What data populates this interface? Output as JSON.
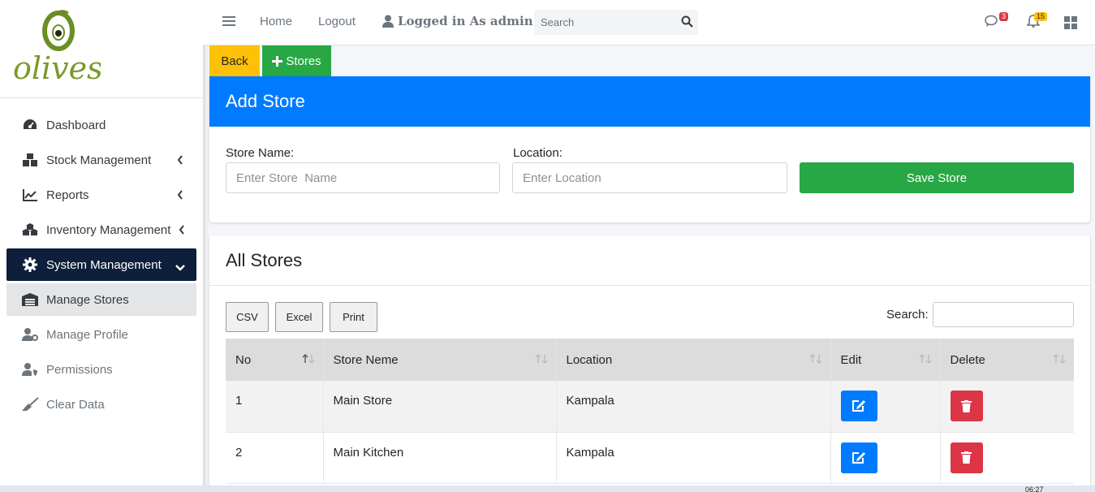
{
  "brand": {
    "logo_text": "olives"
  },
  "sidebar": {
    "items": [
      {
        "label": "Dashboard",
        "icon": "tachometer-icon"
      },
      {
        "label": "Stock Management",
        "icon": "boxes-icon"
      },
      {
        "label": "Reports",
        "icon": "chart-line-icon"
      },
      {
        "label": "Inventory Management",
        "icon": "cubes-icon"
      },
      {
        "label": "System Management",
        "icon": "gear-icon"
      },
      {
        "label": "Manage Stores",
        "icon": "warehouse-icon"
      },
      {
        "label": "Manage Profile",
        "icon": "user-gear-icon"
      },
      {
        "label": "Permissions",
        "icon": "user-shield-icon"
      },
      {
        "label": "Clear Data",
        "icon": "broom-icon"
      }
    ]
  },
  "topbar": {
    "home": "Home",
    "logout": "Logout",
    "user": "Logged in As admin",
    "search_placeholder": "Search",
    "messages_count": "3",
    "notifications_count": "15"
  },
  "actions": {
    "back": "Back",
    "stores": "Stores"
  },
  "add_store": {
    "title": "Add Store",
    "store_name_label": "Store Name:",
    "store_name_placeholder": "Enter Store  Name",
    "location_label": "Location:",
    "location_placeholder": "Enter Location",
    "save": "Save Store"
  },
  "all_stores": {
    "title": "All Stores",
    "buttons": {
      "csv": "CSV",
      "excel": "Excel",
      "print": "Print"
    },
    "search_label": "Search:",
    "columns": [
      "No",
      "Store Neme",
      "Location",
      "Edit",
      "Delete"
    ],
    "rows": [
      {
        "no": "1",
        "name": "Main Store",
        "location": "Kampala"
      },
      {
        "no": "2",
        "name": "Main Kitchen",
        "location": "Kampala"
      }
    ]
  },
  "taskbar": {
    "clock": "06:27"
  },
  "colors": {
    "primary": "#007bff",
    "success": "#28a745",
    "warning": "#ffc107",
    "danger": "#dc3545",
    "sidebar_active": "#0e1f3b"
  }
}
